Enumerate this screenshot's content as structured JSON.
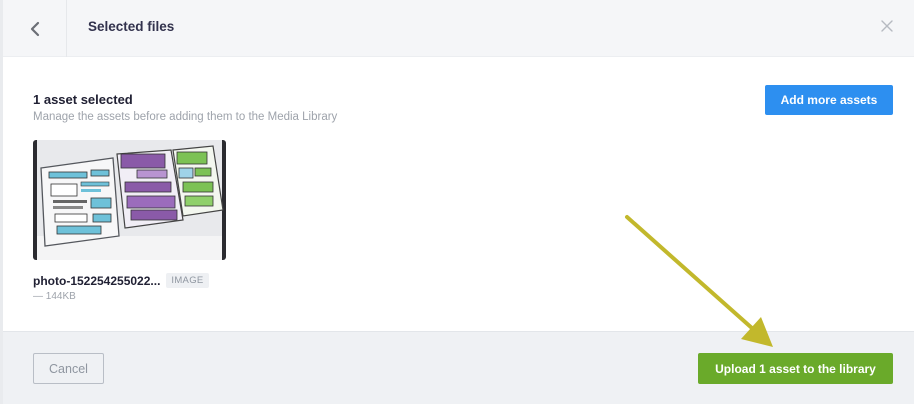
{
  "header": {
    "title": "Selected files"
  },
  "selection": {
    "count_label": "1 asset selected",
    "hint": "Manage the assets before adding them to the Media Library",
    "add_more_label": "Add more assets"
  },
  "asset": {
    "name": "photo-152254255022...",
    "type": "IMAGE",
    "size": "— 144KB"
  },
  "footer": {
    "cancel_label": "Cancel",
    "upload_label": "Upload 1 asset to the library"
  },
  "colors": {
    "primary": "#2d8ff0",
    "success": "#6aaa2a",
    "annotation_arrow": "#c2b82c"
  },
  "icons": {
    "back": "chevron-left-icon",
    "close": "close-icon",
    "annotation": "arrow-annotation-icon"
  }
}
